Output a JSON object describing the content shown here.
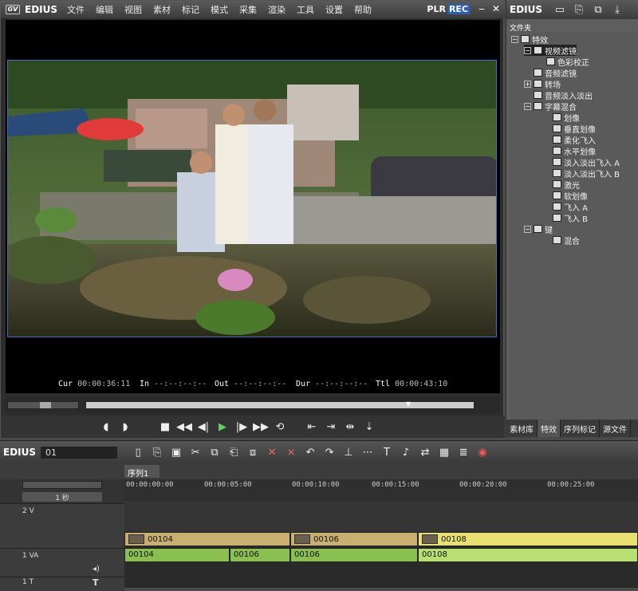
{
  "menubar": {
    "logo": "EDIUS",
    "items": [
      "文件",
      "编辑",
      "视图",
      "素材",
      "标记",
      "模式",
      "采集",
      "渲染",
      "工具",
      "设置",
      "帮助"
    ],
    "plr": "PLR",
    "rec": "REC"
  },
  "timecodes": {
    "cur_label": "Cur",
    "cur": "00:00:36:11",
    "in_label": "In",
    "in": "--:--:--:--",
    "out_label": "Out",
    "out": "--:--:--:--",
    "dur_label": "Dur",
    "dur": "--:--:--:--",
    "ttl_label": "Ttl",
    "ttl": "00:00:43:10"
  },
  "fx": {
    "title": "EDIUS",
    "folder_label": "文件夹",
    "tree": [
      "特效",
      "视频滤镜",
      "色彩校正",
      "音频滤镜",
      "转场",
      "音频淡入淡出",
      "字幕混合",
      "划像",
      "垂直划像",
      "柔化飞入",
      "水平划像",
      "淡入淡出飞入 A",
      "淡入淡出飞入 B",
      "激光",
      "软划像",
      "飞入 A",
      "飞入 B",
      "键",
      "混合"
    ],
    "tabs": [
      "素材库",
      "特效",
      "序列标记",
      "源文件"
    ]
  },
  "timeline": {
    "logo": "EDIUS",
    "seq_num": "01",
    "seq_tab": "序列1",
    "zoom": "1 秒",
    "ruler": [
      "00:00:00:00",
      "00:00:05:00",
      "00:00:10:00",
      "00:00:15:00",
      "00:00:20:00",
      "00:00:25:00"
    ],
    "tracks": [
      "2 V",
      "1 VA",
      "1 T"
    ],
    "video_clips": [
      "00104",
      "00106",
      "00108"
    ],
    "audio_clips": [
      "00104",
      "00106",
      "00106",
      "00108"
    ]
  }
}
